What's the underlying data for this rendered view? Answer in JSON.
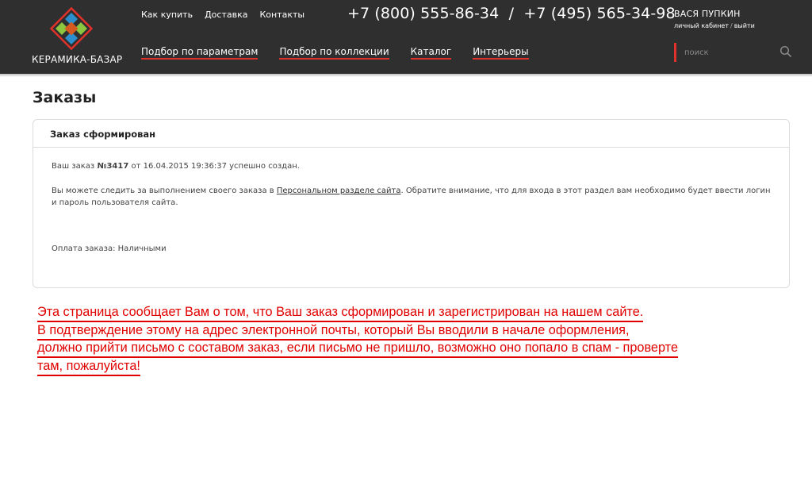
{
  "header": {
    "logo_text": "КЕРАМИКА-БАЗАР",
    "top_links": [
      "Как купить",
      "Доставка",
      "Контакты"
    ],
    "phones": "+7 (800) 555-86-34  /  +7 (495) 565-34-98",
    "main_nav": [
      "Подбор по параметрам",
      "Подбор по коллекции",
      "Каталог",
      "Интерьеры"
    ],
    "user": {
      "name": "ВАСЯ ПУПКИН",
      "cabinet_link": "личный кабинет",
      "separator": "/",
      "logout_link": "выйти"
    },
    "search": {
      "placeholder": "поиск"
    }
  },
  "page": {
    "title": "Заказы",
    "card": {
      "heading": "Заказ сформирован",
      "line1_prefix": "Ваш заказ ",
      "order_number": "№3417",
      "line1_suffix": " от 16.04.2015 19:36:37 успешно создан.",
      "line2_prefix": "Вы можете следить за выполнением своего заказа в ",
      "line2_link": "Персональном разделе сайта",
      "line2_suffix": ". Обратите внимание, что для входа в этот раздел вам необходимо будет ввести логин и пароль пользователя сайта.",
      "payment": "Оплата заказа: Наличными"
    }
  },
  "annotation": {
    "lines": [
      "Эта страница сообщает Вам о том, что Ваш заказ сформирован и зарегистрирован на нашем сайте.",
      "В подтверждение этому на адрес электронной почты, который Вы вводили в начале оформления,",
      "должно прийти письмо с составом заказ, если письмо не пришло, возможно оно попало в спам - проверте",
      "там, пожалуйста!"
    ]
  },
  "colors": {
    "header_bg": "#2f2f2f",
    "accent_red": "#e0312b",
    "annotation_red": "#e10000"
  },
  "icons": {
    "logo": "diamond-logo-icon",
    "search": "search-icon"
  }
}
